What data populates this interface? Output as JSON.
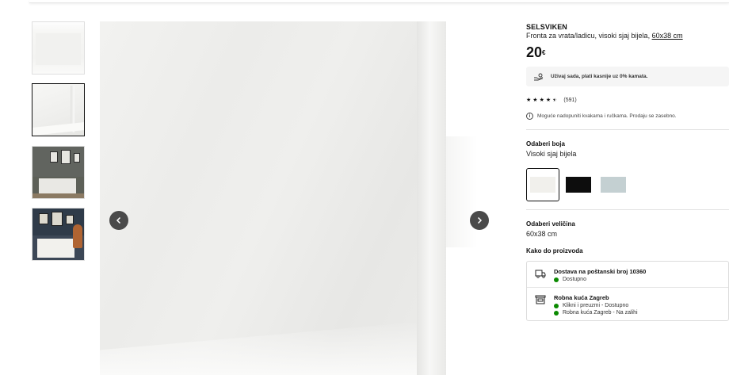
{
  "product": {
    "name": "SELSVIKEN",
    "description": "Fronta za vrata/ladicu, visoki sjaj bijela,",
    "size_link": "60x38 cm",
    "price": "20",
    "currency": "€",
    "financing": "Uživaj sada, plati kasnije uz 0% kamata.",
    "rating_value": 4.5,
    "rating_count": "(591)",
    "note": "Moguće nadopuniti kvakama i ručkama. Prodaju se zasebno."
  },
  "color_section": {
    "title": "Odaberi boja",
    "selected": "Visoki sjaj bijela",
    "swatches": [
      {
        "name": "Visoki sjaj bijela",
        "color": "#f1f0ec",
        "selected": true
      },
      {
        "name": "Visoki sjaj crna",
        "color": "#0d0d0d",
        "selected": false
      },
      {
        "name": "Visoki sjaj svijetlozelena",
        "color": "#c4d0d2",
        "selected": false
      }
    ]
  },
  "size_section": {
    "title": "Odaberi veličina",
    "selected": "60x38 cm"
  },
  "availability": {
    "title": "Kako do proizvoda",
    "delivery": {
      "title": "Dostava na poštanski broj 10360",
      "status": "Dostupno"
    },
    "store": {
      "title": "Robna kuća Zagreb",
      "status1": "Klikni i preuzmi - Dostupno",
      "status2": "Robna kuća Zagreb - Na zalihi"
    }
  },
  "colors": {
    "available": "#0a8a00",
    "nav_button": "#4a4a4a"
  },
  "icons": {
    "prev": "chevron-left-icon",
    "next": "chevron-right-icon",
    "financing": "hand-coin-icon",
    "note": "info-icon",
    "delivery": "truck-icon",
    "store": "store-icon"
  }
}
